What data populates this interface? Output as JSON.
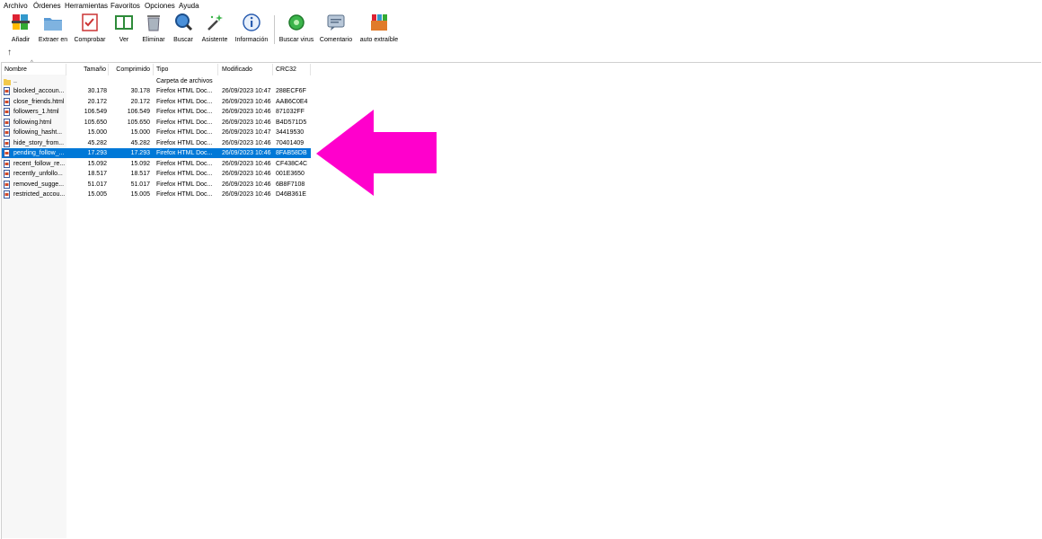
{
  "menu": [
    "Archivo",
    "Órdenes",
    "Herramientas",
    "Favoritos",
    "Opciones",
    "Ayuda"
  ],
  "toolbar": [
    {
      "label": "Añadir",
      "icon": "add-archive-icon"
    },
    {
      "label": "Extraer en",
      "icon": "extract-folder-icon"
    },
    {
      "label": "Comprobar",
      "icon": "test-checklist-icon"
    },
    {
      "label": "Ver",
      "icon": "view-book-icon"
    },
    {
      "label": "Eliminar",
      "icon": "trash-icon"
    },
    {
      "label": "Buscar",
      "icon": "search-magnifier-icon"
    },
    {
      "label": "Asistente",
      "icon": "wizard-wand-icon"
    },
    {
      "label": "Información",
      "icon": "info-icon"
    },
    {
      "label": "Buscar virus",
      "icon": "virus-scan-icon"
    },
    {
      "label": "Comentario",
      "icon": "comment-icon"
    },
    {
      "label": "auto extraíble",
      "icon": "sfx-archive-icon"
    }
  ],
  "columns": {
    "name": "Nombre",
    "size": "Tamaño",
    "packed": "Comprimido",
    "type": "Tipo",
    "modified": "Modificado",
    "crc": "CRC32"
  },
  "parent_row": {
    "name": "..",
    "type": "Carpeta de archivos"
  },
  "files": [
    {
      "name": "blocked_accoun...",
      "size": "30.178",
      "packed": "30.178",
      "type": "Firefox HTML Doc...",
      "modified": "26/09/2023 10:47",
      "crc": "288ECF6F"
    },
    {
      "name": "close_friends.html",
      "size": "20.172",
      "packed": "20.172",
      "type": "Firefox HTML Doc...",
      "modified": "26/09/2023 10:46",
      "crc": "AAB6C0E4"
    },
    {
      "name": "followers_1.html",
      "size": "106.549",
      "packed": "106.549",
      "type": "Firefox HTML Doc...",
      "modified": "26/09/2023 10:46",
      "crc": "871032FF"
    },
    {
      "name": "following.html",
      "size": "105.650",
      "packed": "105.650",
      "type": "Firefox HTML Doc...",
      "modified": "26/09/2023 10:46",
      "crc": "B4D571D5"
    },
    {
      "name": "following_hasht...",
      "size": "15.000",
      "packed": "15.000",
      "type": "Firefox HTML Doc...",
      "modified": "26/09/2023 10:47",
      "crc": "34419530"
    },
    {
      "name": "hide_story_from...",
      "size": "45.282",
      "packed": "45.282",
      "type": "Firefox HTML Doc...",
      "modified": "26/09/2023 10:46",
      "crc": "70401409"
    },
    {
      "name": "pending_follow_...",
      "size": "17.293",
      "packed": "17.293",
      "type": "Firefox HTML Doc...",
      "modified": "26/09/2023 10:46",
      "crc": "8FAB58DB",
      "selected": true
    },
    {
      "name": "recent_follow_re...",
      "size": "15.092",
      "packed": "15.092",
      "type": "Firefox HTML Doc...",
      "modified": "26/09/2023 10:46",
      "crc": "CF438C4C"
    },
    {
      "name": "recently_unfollo...",
      "size": "18.517",
      "packed": "18.517",
      "type": "Firefox HTML Doc...",
      "modified": "26/09/2023 10:46",
      "crc": "001E3650"
    },
    {
      "name": "removed_sugge...",
      "size": "51.017",
      "packed": "51.017",
      "type": "Firefox HTML Doc...",
      "modified": "26/09/2023 10:46",
      "crc": "6B8F7108"
    },
    {
      "name": "restricted_accou...",
      "size": "15.005",
      "packed": "15.005",
      "type": "Firefox HTML Doc...",
      "modified": "26/09/2023 10:46",
      "crc": "D46B361E"
    }
  ],
  "colors": {
    "selection": "#0078d7",
    "arrow": "#ff00cc"
  }
}
